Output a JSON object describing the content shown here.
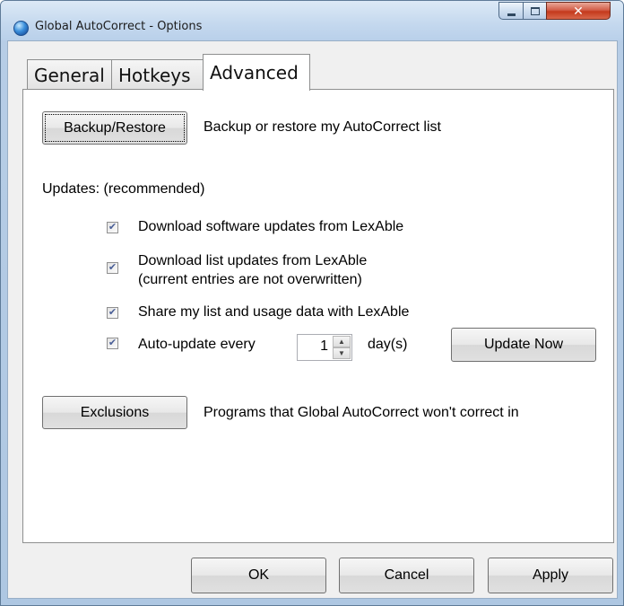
{
  "window": {
    "title": "Global AutoCorrect - Options",
    "close_glyph": "✕",
    "icon": "globe-icon"
  },
  "tabs": [
    {
      "label": "General",
      "selected": false
    },
    {
      "label": "Hotkeys",
      "selected": false
    },
    {
      "label": "Advanced",
      "selected": true
    }
  ],
  "advanced": {
    "backup_button": "Backup/Restore",
    "backup_desc": "Backup or restore my AutoCorrect list",
    "updates_heading": "Updates: (recommended)",
    "options": [
      {
        "label": "Download software updates from LexAble",
        "checked": true
      },
      {
        "label_line1": "Download list updates from LexAble",
        "label_line2": "(current entries are not overwritten)",
        "checked": true
      },
      {
        "label": "Share my list and usage data with LexAble",
        "checked": true
      },
      {
        "label": "Auto-update every",
        "checked": true
      }
    ],
    "auto_update_days": "1",
    "days_unit": "day(s)",
    "update_now_button": "Update Now",
    "exclusions_button": "Exclusions",
    "exclusions_desc": "Programs that Global AutoCorrect won't correct in"
  },
  "footer": {
    "ok": "OK",
    "cancel": "Cancel",
    "apply": "Apply"
  },
  "glyphs": {
    "check": "✔",
    "spin_up": "▲",
    "spin_down": "▼"
  }
}
